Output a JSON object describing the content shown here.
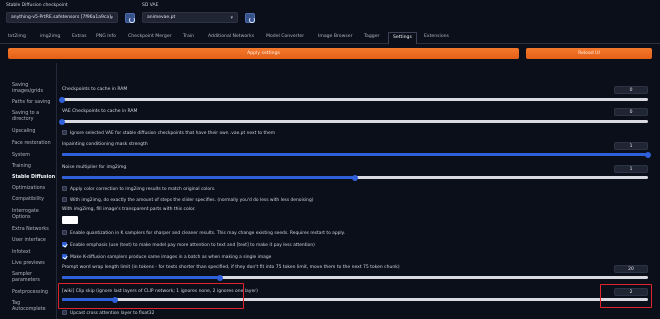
{
  "header": {
    "checkpoint_label": "Stable Diffusion checkpoint",
    "checkpoint_value": "anything-v5-PrtRE.safetensors [7f96a1a9ca]",
    "vae_label": "SD VAE",
    "vae_value": "animevae.pt"
  },
  "tabs": [
    "txt2img",
    "img2img",
    "Extras",
    "PNG Info",
    "Checkpoint Merger",
    "Train",
    "Additional Networks",
    "Model Converter",
    "Image Browser",
    "Tagger",
    "Settings",
    "Extensions"
  ],
  "buttons": {
    "apply": "Apply settings",
    "reload": "Reload UI"
  },
  "sidebar": [
    "Saving",
    "images/grids",
    "Paths for saving",
    "Saving to a",
    "directory",
    "Upscaling",
    "Face restoration",
    "System",
    "Training",
    "Stable Diffusion",
    "Optimizations",
    "Compatibility",
    "Interrogate",
    "Options",
    "Extra Networks",
    "User interface",
    "Infotext",
    "Live previews",
    "Sampler",
    "parameters",
    "Postprocessing",
    "Tag",
    "Autocomplete"
  ],
  "settings": {
    "ckpt_cache_label": "Checkpoints to cache in RAM",
    "ckpt_cache_value": "0",
    "vae_cache_label": "VAE Checkpoints to cache in RAM",
    "vae_cache_value": "0",
    "ignore_vae_label": "Ignore selected VAE for stable diffusion checkpoints that have their own .vae.pt next to them",
    "inpaint_label": "Inpainting conditioning mask strength",
    "inpaint_value": "1",
    "noise_label": "Noise multiplier for img2img",
    "noise_value": "1",
    "color_correction_label": "Apply color correction to img2img results to match original colors.",
    "exact_steps_label": "With img2img, do exactly the amount of steps the slider specifies. (normally you'd do less with less denoising)",
    "fill_color_label": "With img2img, fill image's transparent parts with this color.",
    "quantization_label": "Enable quantization in K samplers for sharper and cleaner results. This may change existing seeds. Requires restart to apply.",
    "emphasis_label": "Enable emphasis (use (text) to make model pay more attention to text and [text] to make it pay less attention)",
    "batch_cond_label": "Make K-diffusion samplers produce same images in a batch as when making a single image",
    "prompt_wrap_label": "Prompt word wrap length limit (in tokens - for texts shorter than specified, if they don't fit into 75 token limit, move them to the next 75 token chunk)",
    "prompt_wrap_value": "20",
    "clip_skip_label": "[wiki] Clip skip (ignore last layers of CLIP network; 1 ignores none, 2 ignores one layer)",
    "clip_skip_value": "2",
    "upcast_label": "Upcast cross attention layer to float32"
  },
  "slider_levels": {
    "ckpt_cache": 0.0,
    "vae_cache": 0.0,
    "inpaint": 1.0,
    "noise": 0.5,
    "prompt_wrap": 0.27,
    "clip_skip": 0.09
  },
  "colors": {
    "accent": "#2f5fd9",
    "apply": "#f26d22",
    "highlight": "#e0242b",
    "background": "#0b0f19"
  }
}
